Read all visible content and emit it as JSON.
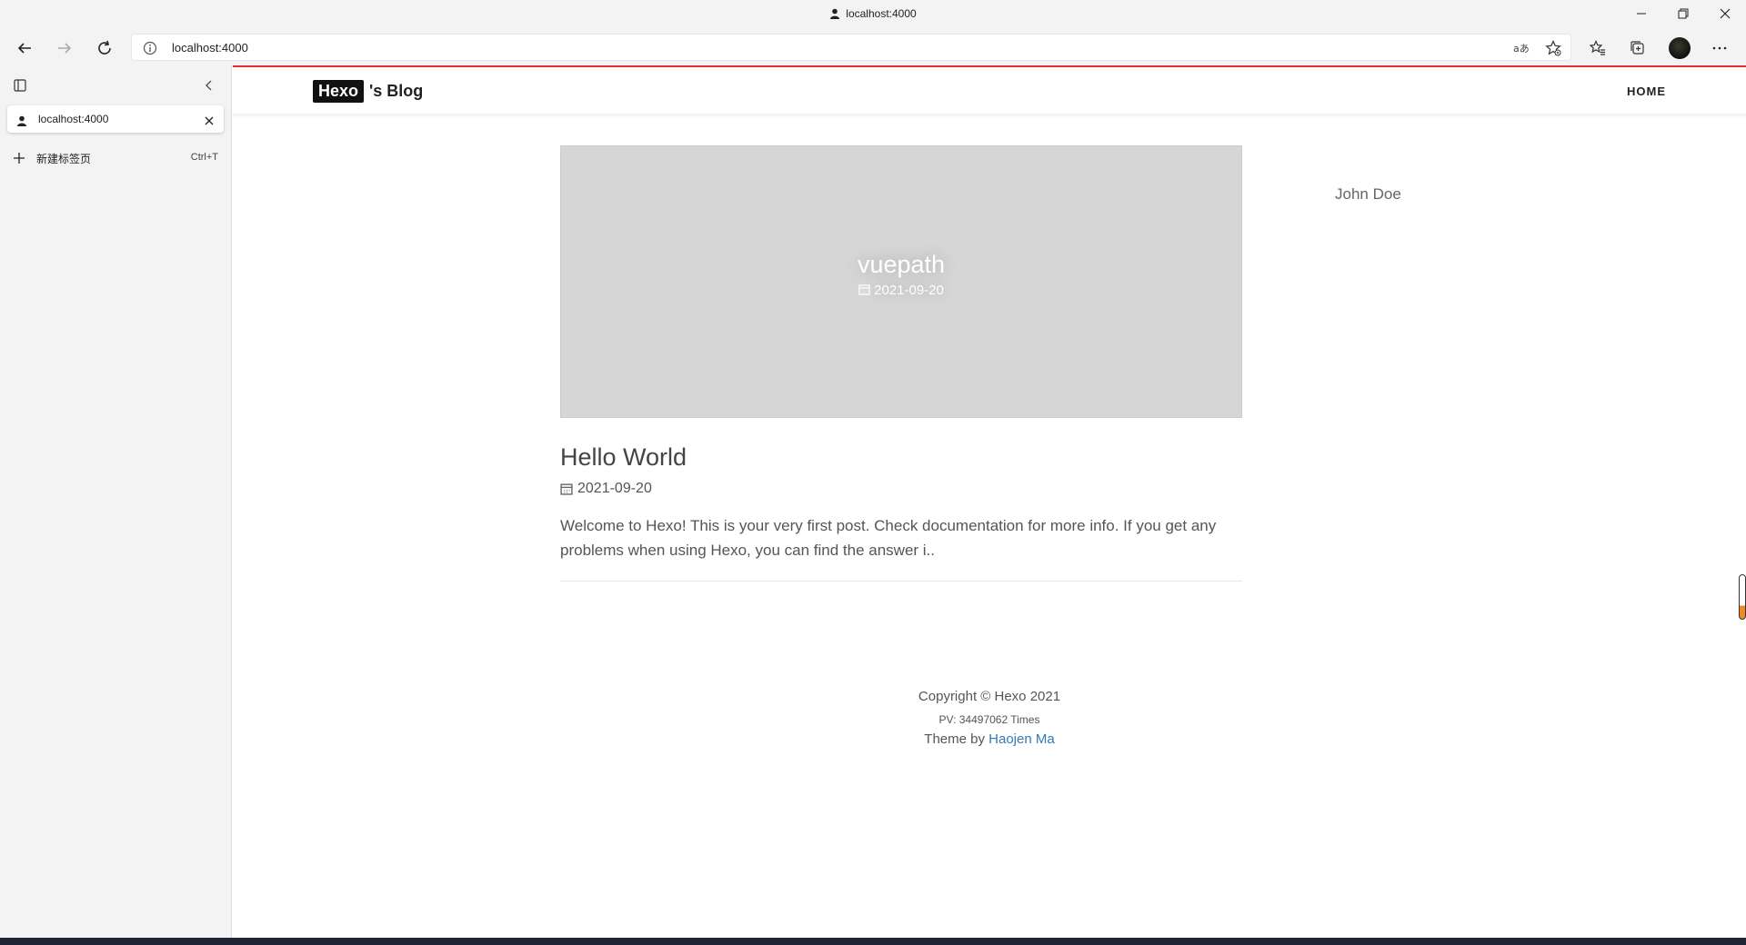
{
  "browser": {
    "window_title": "localhost:4000",
    "url": "localhost:4000"
  },
  "sidebar": {
    "tabs": [
      {
        "label": "localhost:4000"
      }
    ],
    "new_tab_label": "新建标签页",
    "new_tab_shortcut": "Ctrl+T"
  },
  "site": {
    "brand": "Hexo",
    "title_suffix": "'s Blog",
    "nav": [
      {
        "label": "HOME"
      }
    ],
    "accent_color": "#e0312f"
  },
  "cover": {
    "title": "vuepath",
    "date": "2021-09-20"
  },
  "post": {
    "title": "Hello World",
    "date": "2021-09-20",
    "excerpt": "Welcome to Hexo! This is your very first post. Check documentation for more info. If you get any problems when using Hexo, you can find the answer i.."
  },
  "sidebar_widget": {
    "author": "John Doe"
  },
  "footer": {
    "copyright": "Copyright © Hexo 2021",
    "pv": "PV: 34497062 Times",
    "theme_prefix": "Theme by ",
    "theme_author": "Haojen Ma",
    "link_color": "#337ab7"
  }
}
